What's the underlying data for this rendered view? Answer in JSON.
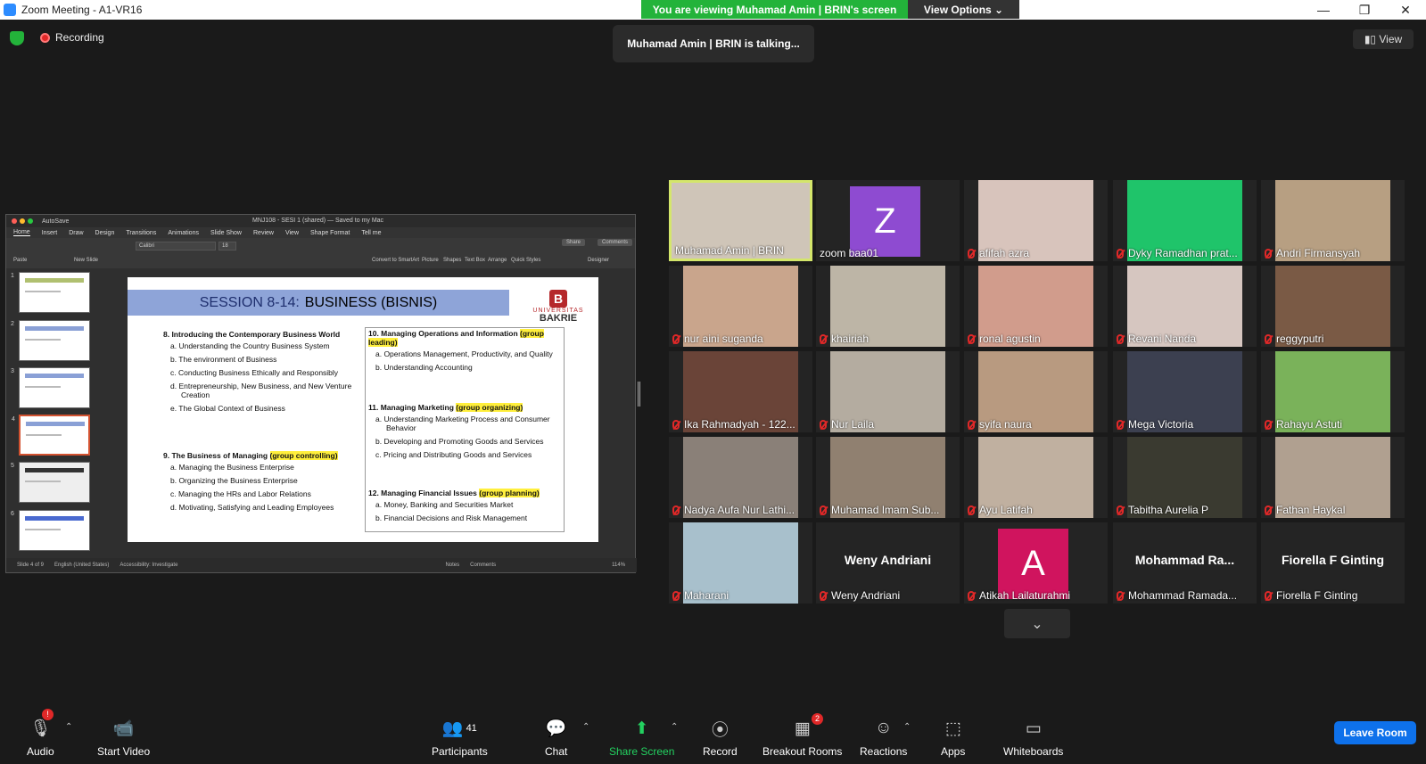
{
  "window": {
    "title": "Zoom Meeting - A1-VR16",
    "controls": [
      "—",
      "❐",
      "✕"
    ]
  },
  "banner": {
    "viewing": "You are viewing Muhamad Amin | BRIN's screen",
    "view_options": "View Options ⌄"
  },
  "status": {
    "recording": "Recording",
    "talking": "Muhamad Amin | BRIN is talking...",
    "view": "View"
  },
  "ppt": {
    "filename": "MNJ108 - SESI 1 (shared) — Saved to my Mac",
    "autosave": "AutoSave",
    "tabs": [
      "Home",
      "Insert",
      "Draw",
      "Design",
      "Transitions",
      "Animations",
      "Slide Show",
      "Review",
      "View",
      "Shape Format",
      "Tell me"
    ],
    "font": "Calibri",
    "font_size": "18",
    "share": "Share",
    "comments": "Comments",
    "ribbon_labels": [
      "Paste",
      "New Slide",
      "Convert to SmartArt",
      "Picture",
      "Shapes",
      "Text Box",
      "Arrange",
      "Quick Styles",
      "Designer"
    ],
    "slide_numbers": [
      "1",
      "2",
      "3",
      "4",
      "5",
      "6"
    ],
    "slide": {
      "title_a": "SESSION 8-14:",
      "title_b": "BUSINESS (BISNIS)",
      "logo_a": "UNIVERSITAS",
      "logo_b": "BAKRIE",
      "logo_mark": "B",
      "s8": {
        "head": "8.   Introducing the Contemporary Business World",
        "items": [
          "a.  Understanding the Country Business System",
          "b.  The environment of Business",
          "c.  Conducting Business Ethically and Responsibly",
          "d.  Entrepreneurship, New Business, and New Venture Creation",
          "e.  The Global Context of Business"
        ]
      },
      "s9": {
        "head": "9.   The Business of Managing",
        "tag": "(group controlling)",
        "items": [
          "a.  Managing the Business Enterprise",
          "b.  Organizing the Business Enterprise",
          "c.  Managing the HRs and Labor Relations",
          "d.  Motivating, Satisfying and Leading Employees"
        ]
      },
      "s10": {
        "head": "10. Managing Operations and Information",
        "tag": "(group leading)",
        "items": [
          "a.  Operations Management, Productivity, and Quality",
          "b.  Understanding Accounting"
        ]
      },
      "s11": {
        "head": "11. Managing Marketing",
        "tag": "(group organizing)",
        "items": [
          "a.  Understanding Marketing Process and Consumer Behavior",
          "b.  Developing and Promoting Goods and Services",
          "c.  Pricing and Distributing Goods and Services"
        ]
      },
      "s12": {
        "head": "12. Managing Financial Issues",
        "tag": "(group planning)",
        "items": [
          "a.  Money, Banking and Securities Market",
          "b.  Financial Decisions and Risk Management"
        ]
      }
    },
    "statusbar": {
      "slide": "Slide 4 of 9",
      "lang": "English (United States)",
      "access": "Accessibility: Investigate",
      "notes": "Notes",
      "comments": "Comments",
      "zoom": "114%"
    }
  },
  "participants": [
    {
      "name": "Muhamad Amin | BRIN",
      "muted": false,
      "active": true,
      "bg": "#cfc5b8"
    },
    {
      "name": "zoom baa01",
      "muted": false,
      "avatar": "Z",
      "avatar_color": "#8e4bd1"
    },
    {
      "name": "afifah azra",
      "muted": true,
      "bg": "#d8c4bc"
    },
    {
      "name": "Dyky Ramadhan prat...",
      "muted": true,
      "bg": "#1fc46a"
    },
    {
      "name": "Andri Firmansyah",
      "muted": true,
      "bg": "#b79f82"
    },
    {
      "name": "nur aini suganda",
      "muted": true,
      "bg": "#c9a58c"
    },
    {
      "name": "khairiah",
      "muted": true,
      "bg": "#bdb5a6"
    },
    {
      "name": "ronal agustin",
      "muted": true,
      "bg": "#d19c8c"
    },
    {
      "name": "Revani Nanda",
      "muted": true,
      "bg": "#d6c6c0"
    },
    {
      "name": "reggyputri",
      "muted": true,
      "bg": "#7a5a45"
    },
    {
      "name": "Ika Rahmadyah - 122...",
      "muted": true,
      "bg": "#6a4438"
    },
    {
      "name": "Nur Laila",
      "muted": true,
      "bg": "#b4aca0"
    },
    {
      "name": "syifa naura",
      "muted": true,
      "bg": "#b89a80"
    },
    {
      "name": "Mega Victoria",
      "muted": true,
      "bg": "#3c4050"
    },
    {
      "name": "Rahayu Astuti",
      "muted": true,
      "bg": "#7ab25a"
    },
    {
      "name": "Nadya Aufa Nur Lathi...",
      "muted": true,
      "bg": "#8a8078"
    },
    {
      "name": "Muhamad Imam Sub...",
      "muted": true,
      "bg": "#908070"
    },
    {
      "name": "Ayu Latifah",
      "muted": true,
      "bg": "#c0b0a0"
    },
    {
      "name": "Tabitha Aurelia P",
      "muted": true,
      "bg": "#3a3a30"
    },
    {
      "name": "Fathan Haykal",
      "muted": true,
      "bg": "#b0a090"
    },
    {
      "name": "Maharani",
      "muted": true,
      "bg": "#a8c0cc"
    },
    {
      "name": "Weny Andriani",
      "muted": true,
      "big": "Weny Andriani"
    },
    {
      "name": "Atikah Lailaturahmi",
      "muted": true,
      "avatar": "A",
      "avatar_color": "#d0145e"
    },
    {
      "name": "Mohammad Ramada...",
      "muted": true,
      "big": "Mohammad  Ra..."
    },
    {
      "name": "Fiorella F Ginting",
      "muted": true,
      "big": "Fiorella F Ginting"
    }
  ],
  "more": "⌄",
  "toolbar": {
    "audio": "Audio",
    "video": "Start Video",
    "participants": "Participants",
    "participants_count": "41",
    "chat": "Chat",
    "share": "Share Screen",
    "record": "Record",
    "breakout": "Breakout Rooms",
    "breakout_count": "2",
    "reactions": "Reactions",
    "apps": "Apps",
    "whiteboards": "Whiteboards",
    "leave": "Leave Room",
    "audio_badge": "!"
  }
}
